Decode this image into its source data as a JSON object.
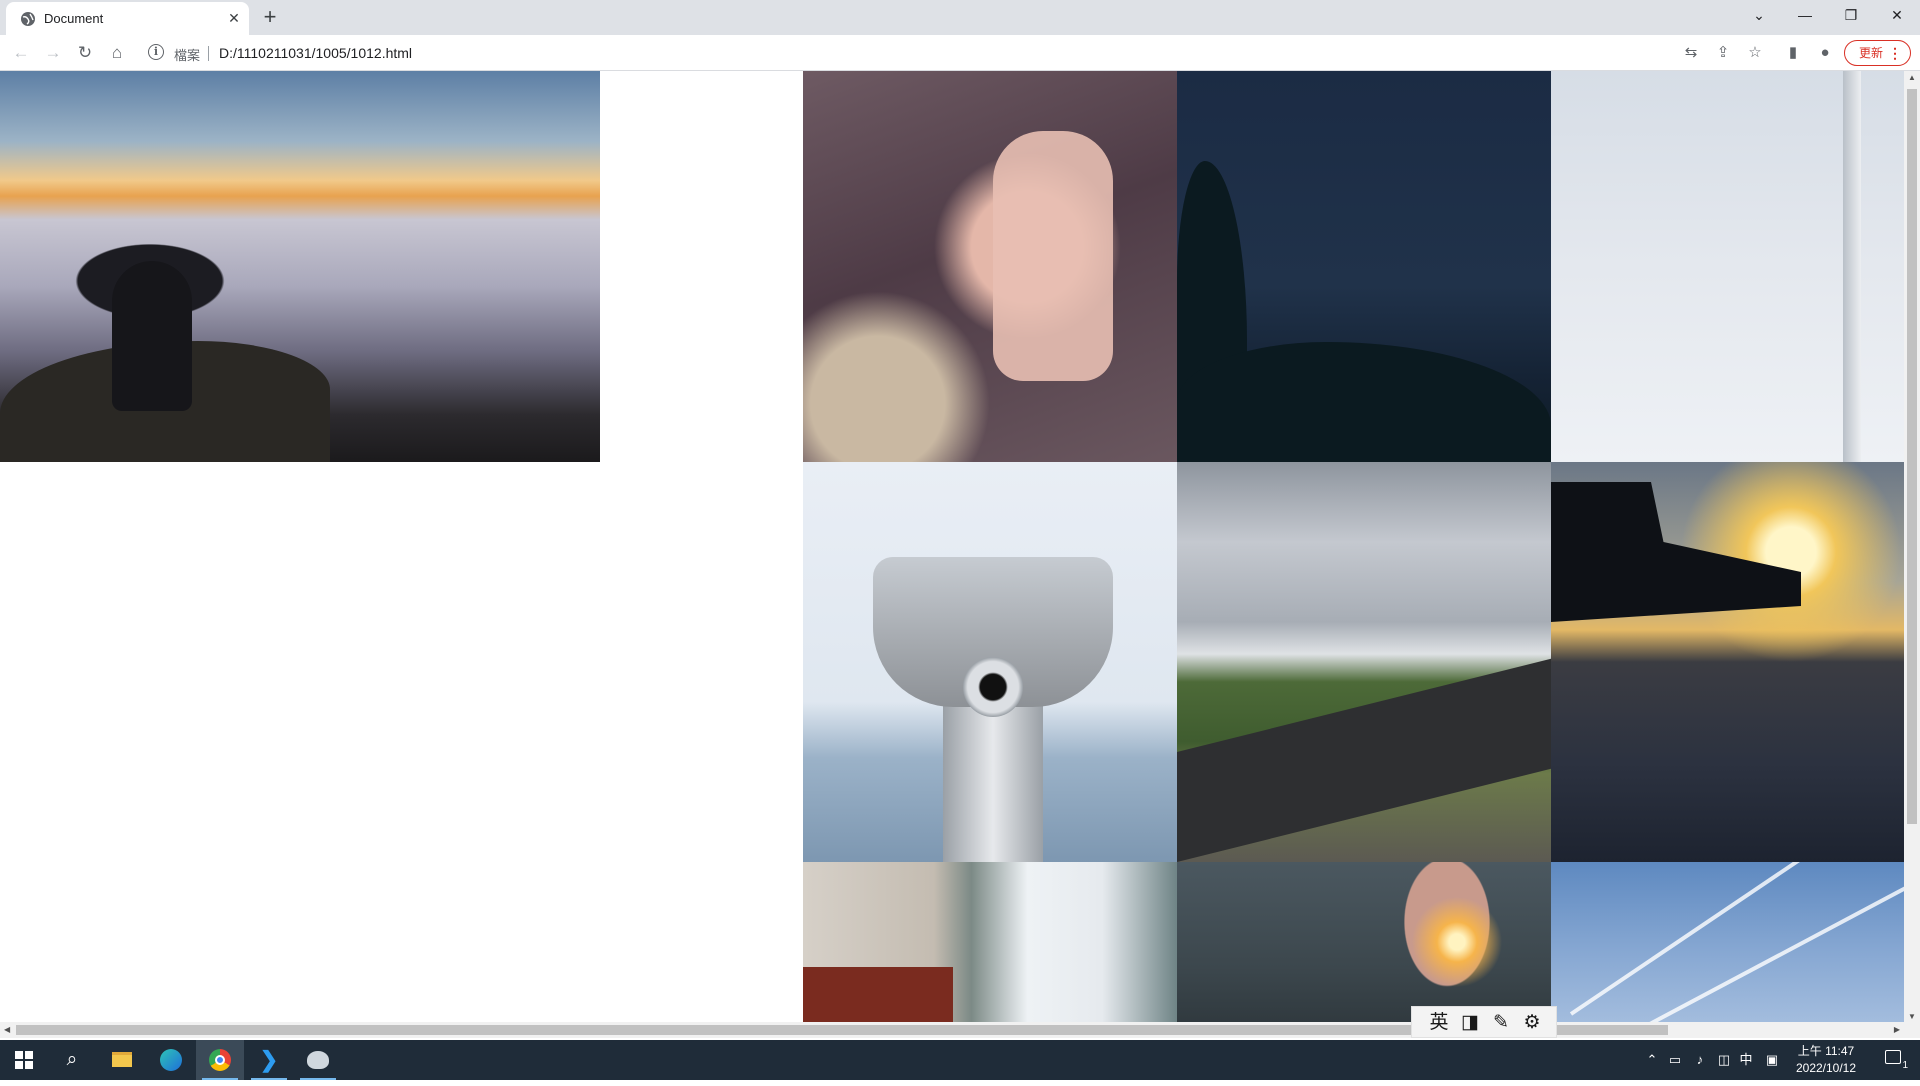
{
  "browser": {
    "tab_title": "Document",
    "tab_close": "✕",
    "new_tab": "+",
    "scheme_label": "檔案",
    "url": "D:/1110211031/1005/1012.html",
    "update_label": "更新",
    "update_dots": "⋮"
  },
  "window_controls": {
    "tab_search": "⌄",
    "minimize": "—",
    "restore": "❐",
    "close": "✕"
  },
  "page": {
    "photos": [
      "clouds-hiker",
      "hand-rain-window",
      "night-sky-trees",
      "sky-pole",
      "coin-binoculars",
      "mountain-road",
      "pier-sunset",
      "city-street",
      "sparkler",
      "contrails-sky"
    ]
  },
  "ime": {
    "lang": "英",
    "mode": "◨",
    "tools": "✎",
    "settings": "⚙"
  },
  "taskbar": {
    "ime_tray": "中",
    "clock_period_time": "上午 11:47",
    "clock_date": "2022/10/12",
    "notification_count": "1"
  },
  "colors": {
    "tabstrip": "#dee1e6",
    "taskbar": "#1f2c39",
    "update_accent": "#d93025"
  }
}
